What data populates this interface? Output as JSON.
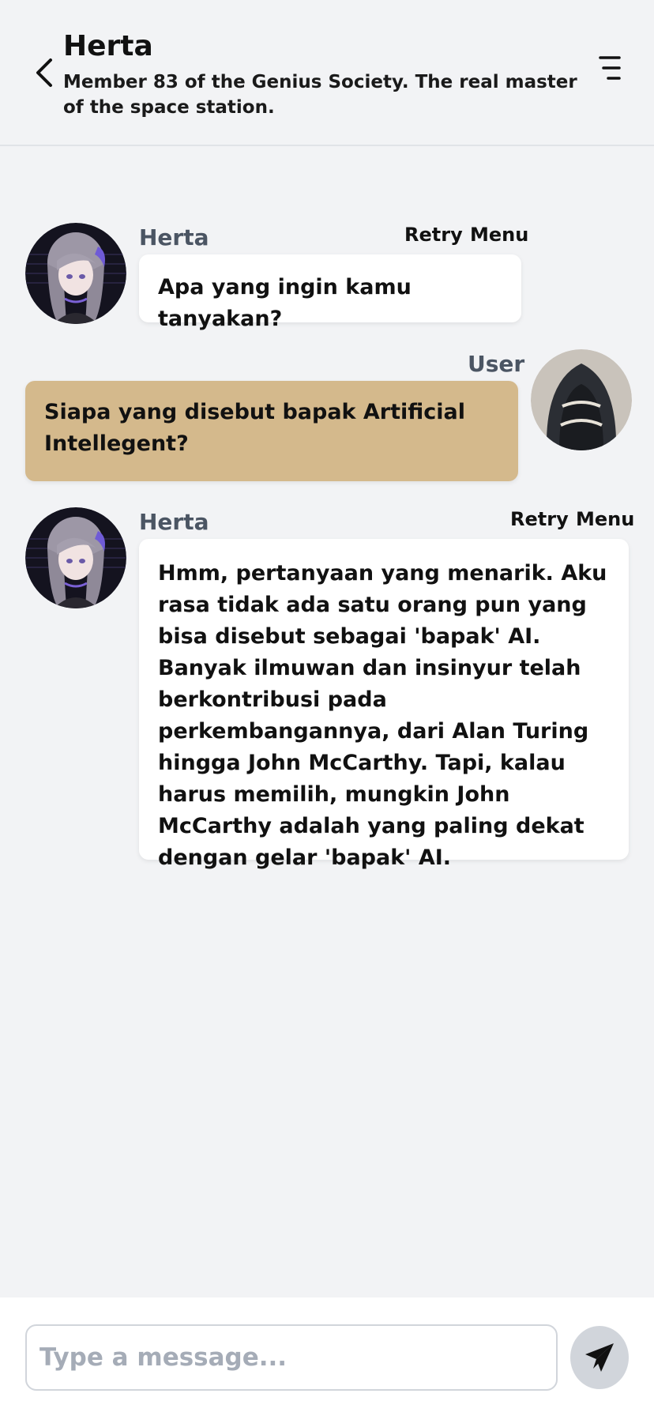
{
  "header": {
    "title": "Herta",
    "subtitle": "Member 83 of the Genius Society. The real master of the space station.",
    "back_icon": "chevron-left-icon",
    "menu_icon": "menu-icon"
  },
  "messages": [
    {
      "sender": "Herta",
      "role": "bot",
      "retry_label": "Retry",
      "menu_label": "Menu",
      "text": "Apa yang ingin kamu tanyakan?"
    },
    {
      "sender": "User",
      "role": "user",
      "text": "Siapa yang disebut bapak Artificial Intellegent?"
    },
    {
      "sender": "Herta",
      "role": "bot",
      "retry_label": "Retry",
      "menu_label": "Menu",
      "text": "Hmm, pertanyaan yang menarik. Aku rasa tidak ada satu orang pun yang bisa disebut sebagai 'bapak' AI. Banyak ilmuwan dan insinyur telah berkontribusi pada perkembangannya, dari Alan Turing hingga John McCarthy. Tapi, kalau harus memilih, mungkin John McCarthy adalah yang paling dekat dengan gelar 'bapak' AI."
    }
  ],
  "composer": {
    "placeholder": "Type a message...",
    "value": "",
    "send_icon": "send-icon"
  },
  "colors": {
    "background": "#f2f3f5",
    "user_bubble": "#d4b98c",
    "bot_bubble": "#ffffff",
    "name_text": "#4b5563",
    "send_button": "#d1d5db"
  }
}
